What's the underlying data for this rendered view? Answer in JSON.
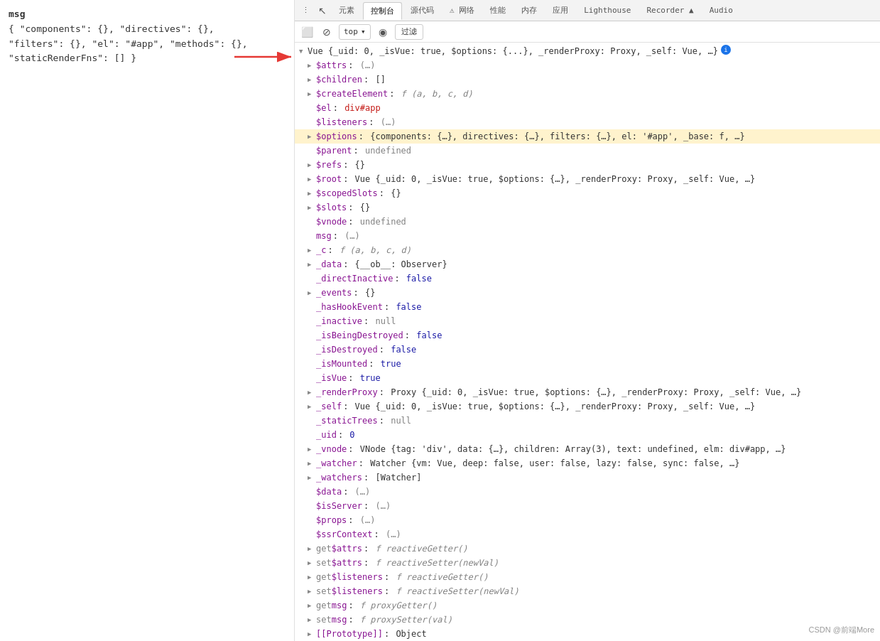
{
  "left_panel": {
    "line1": "msg",
    "line2": "{ \"components\": {}, \"directives\": {},",
    "line3": "\"filters\": {}, \"el\": \"#app\", \"methods\": {},",
    "line4": "\"staticRenderFns\": [] }"
  },
  "toolbar": {
    "top_label": "top",
    "filter_label": "过滤",
    "chevron_icon": "▾",
    "eye_icon": "◉",
    "back_icon": "←",
    "block_icon": "⊘",
    "sidebar_icon": "⬜"
  },
  "tabs": [
    {
      "label": "元素",
      "active": false
    },
    {
      "label": "控制台",
      "active": true
    },
    {
      "label": "源代码",
      "active": false
    },
    {
      "label": "⚠ 网络",
      "active": false
    },
    {
      "label": "性能",
      "active": false
    },
    {
      "label": "内存",
      "active": false
    },
    {
      "label": "应用",
      "active": false
    },
    {
      "label": "Lighthouse",
      "active": false
    },
    {
      "label": "Recorder ▲",
      "active": false
    },
    {
      "label": "Audio",
      "active": false
    }
  ],
  "console": {
    "root_obj": "Vue {_uid: 0, _isVue: true, $options: {...}, _renderProxy: Proxy, _self: Vue, …}",
    "info_icon": "i",
    "lines": [
      {
        "indent": 1,
        "triangle": "right",
        "prop": "$attrs",
        "colon": ":",
        "value": "(…)",
        "value_type": "undef"
      },
      {
        "indent": 1,
        "triangle": "right",
        "prop": "$children",
        "colon": ":",
        "value": "[]",
        "value_type": "obj"
      },
      {
        "indent": 1,
        "triangle": "right",
        "prop": "$createElement",
        "colon": ":",
        "value": "f (a, b, c, d)",
        "value_type": "func"
      },
      {
        "indent": 1,
        "triangle": "none",
        "prop": "$el",
        "colon": ":",
        "value": "div#app",
        "value_type": "string"
      },
      {
        "indent": 1,
        "triangle": "none",
        "prop": "$listeners",
        "colon": ":",
        "value": "(…)",
        "value_type": "undef"
      },
      {
        "indent": 1,
        "triangle": "none",
        "prop": "$options",
        "colon": ":",
        "value": "{components: {…}, directives: {…}, filters: {…}, el: '#app', _base: f, …}",
        "value_type": "obj",
        "highlighted": true
      },
      {
        "indent": 1,
        "triangle": "none",
        "prop": "$parent",
        "colon": ":",
        "value": "undefined",
        "value_type": "undef"
      },
      {
        "indent": 1,
        "triangle": "right",
        "prop": "$refs",
        "colon": ":",
        "value": "{}",
        "value_type": "obj"
      },
      {
        "indent": 1,
        "triangle": "right",
        "prop": "$root",
        "colon": ":",
        "value": "Vue {_uid: 0, _isVue: true, $options: {…}, _renderProxy: Proxy, _self: Vue, …}",
        "value_type": "obj"
      },
      {
        "indent": 1,
        "triangle": "right",
        "prop": "$scopedSlots",
        "colon": ":",
        "value": "{}",
        "value_type": "obj"
      },
      {
        "indent": 1,
        "triangle": "right",
        "prop": "$slots",
        "colon": ":",
        "value": "{}",
        "value_type": "obj"
      },
      {
        "indent": 1,
        "triangle": "none",
        "prop": "$vnode",
        "colon": ":",
        "value": "undefined",
        "value_type": "undef"
      },
      {
        "indent": 1,
        "triangle": "none",
        "prop": "msg",
        "colon": ":",
        "value": "(…)",
        "value_type": "undef"
      },
      {
        "indent": 1,
        "triangle": "right",
        "prop": "_c",
        "colon": ":",
        "value": "f (a, b, c, d)",
        "value_type": "func"
      },
      {
        "indent": 1,
        "triangle": "right",
        "prop": "_data",
        "colon": ":",
        "value": "{__ob__: Observer}",
        "value_type": "obj"
      },
      {
        "indent": 1,
        "triangle": "none",
        "prop": "_directInactive",
        "colon": ":",
        "value": "false",
        "value_type": "bool"
      },
      {
        "indent": 1,
        "triangle": "right",
        "prop": "_events",
        "colon": ":",
        "value": "{}",
        "value_type": "obj"
      },
      {
        "indent": 1,
        "triangle": "none",
        "prop": "_hasHookEvent",
        "colon": ":",
        "value": "false",
        "value_type": "bool"
      },
      {
        "indent": 1,
        "triangle": "none",
        "prop": "_inactive",
        "colon": ":",
        "value": "null",
        "value_type": "null"
      },
      {
        "indent": 1,
        "triangle": "none",
        "prop": "_isBeingDestroyed",
        "colon": ":",
        "value": "false",
        "value_type": "bool"
      },
      {
        "indent": 1,
        "triangle": "none",
        "prop": "_isDestroyed",
        "colon": ":",
        "value": "false",
        "value_type": "bool"
      },
      {
        "indent": 1,
        "triangle": "none",
        "prop": "_isMounted",
        "colon": ":",
        "value": "true",
        "value_type": "bool"
      },
      {
        "indent": 1,
        "triangle": "none",
        "prop": "_isVue",
        "colon": ":",
        "value": "true",
        "value_type": "bool"
      },
      {
        "indent": 1,
        "triangle": "right",
        "prop": "_renderProxy",
        "colon": ":",
        "value": "Proxy {_uid: 0, _isVue: true, $options: {…}, _renderProxy: Proxy, _self: Vue, …}",
        "value_type": "obj"
      },
      {
        "indent": 1,
        "triangle": "right",
        "prop": "_self",
        "colon": ":",
        "value": "Vue {_uid: 0, _isVue: true, $options: {…}, _renderProxy: Proxy, _self: Vue, …}",
        "value_type": "obj"
      },
      {
        "indent": 1,
        "triangle": "none",
        "prop": "_staticTrees",
        "colon": ":",
        "value": "null",
        "value_type": "null"
      },
      {
        "indent": 1,
        "triangle": "none",
        "prop": "_uid",
        "colon": ":",
        "value": "0",
        "value_type": "num"
      },
      {
        "indent": 1,
        "triangle": "right",
        "prop": "_vnode",
        "colon": ":",
        "value": "VNode {tag: 'div', data: {…}, children: Array(3), text: undefined, elm: div#app, …}",
        "value_type": "obj"
      },
      {
        "indent": 1,
        "triangle": "right",
        "prop": "_watcher",
        "colon": ":",
        "value": "Watcher {vm: Vue, deep: false, user: false, lazy: false, sync: false, …}",
        "value_type": "obj"
      },
      {
        "indent": 1,
        "triangle": "right",
        "prop": "_watchers",
        "colon": ":",
        "value": "[Watcher]",
        "value_type": "obj"
      },
      {
        "indent": 1,
        "triangle": "none",
        "prop": "$data",
        "colon": ":",
        "value": "(…)",
        "value_type": "getter",
        "getter": true
      },
      {
        "indent": 1,
        "triangle": "none",
        "prop": "$isServer",
        "colon": ":",
        "value": "(…)",
        "value_type": "getter",
        "getter": true
      },
      {
        "indent": 1,
        "triangle": "none",
        "prop": "$props",
        "colon": ":",
        "value": "(…)",
        "value_type": "getter",
        "getter": true
      },
      {
        "indent": 1,
        "triangle": "none",
        "prop": "$ssrContext",
        "colon": ":",
        "value": "(…)",
        "value_type": "getter",
        "getter": true
      },
      {
        "indent": 1,
        "triangle": "right",
        "prop": "get $attrs",
        "colon": ":",
        "value": "f reactiveGetter()",
        "value_type": "func",
        "accessor": "get"
      },
      {
        "indent": 1,
        "triangle": "right",
        "prop": "set $attrs",
        "colon": ":",
        "value": "f reactiveSetter(newVal)",
        "value_type": "func",
        "accessor": "set"
      },
      {
        "indent": 1,
        "triangle": "right",
        "prop": "get $listeners",
        "colon": ":",
        "value": "f reactiveGetter()",
        "value_type": "func",
        "accessor": "get"
      },
      {
        "indent": 1,
        "triangle": "right",
        "prop": "set $listeners",
        "colon": ":",
        "value": "f reactiveSetter(newVal)",
        "value_type": "func",
        "accessor": "set"
      },
      {
        "indent": 1,
        "triangle": "right",
        "prop": "get msg",
        "colon": ":",
        "value": "f proxyGetter()",
        "value_type": "func",
        "accessor": "get"
      },
      {
        "indent": 1,
        "triangle": "right",
        "prop": "set msg",
        "colon": ":",
        "value": "f proxySetter(val)",
        "value_type": "func",
        "accessor": "set"
      },
      {
        "indent": 1,
        "triangle": "right",
        "prop": "[[Prototype]]",
        "colon": ":",
        "value": "Object",
        "value_type": "obj"
      }
    ]
  },
  "watermark": "CSDN @前端More"
}
